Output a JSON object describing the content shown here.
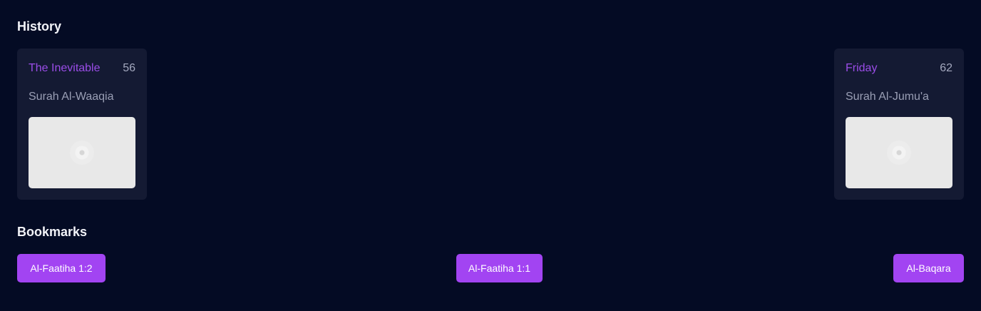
{
  "colors": {
    "background": "#040b24",
    "card": "#141a33",
    "accent": "#a244f2",
    "surah_name": "#9b4de8",
    "muted_text": "#9a9fb5"
  },
  "history": {
    "title": "History",
    "items": [
      {
        "name": "The Inevitable",
        "number": "56",
        "surah": "Surah Al-Waaqia",
        "thumbnail_icon": "loading-spinner-icon"
      },
      {
        "name": "Friday",
        "number": "62",
        "surah": "Surah Al-Jumu'a",
        "thumbnail_icon": "loading-spinner-icon"
      }
    ]
  },
  "bookmarks": {
    "title": "Bookmarks",
    "items": [
      {
        "label": "Al-Faatiha 1:2"
      },
      {
        "label": "Al-Faatiha 1:1"
      },
      {
        "label": "Al-Baqara"
      }
    ]
  }
}
